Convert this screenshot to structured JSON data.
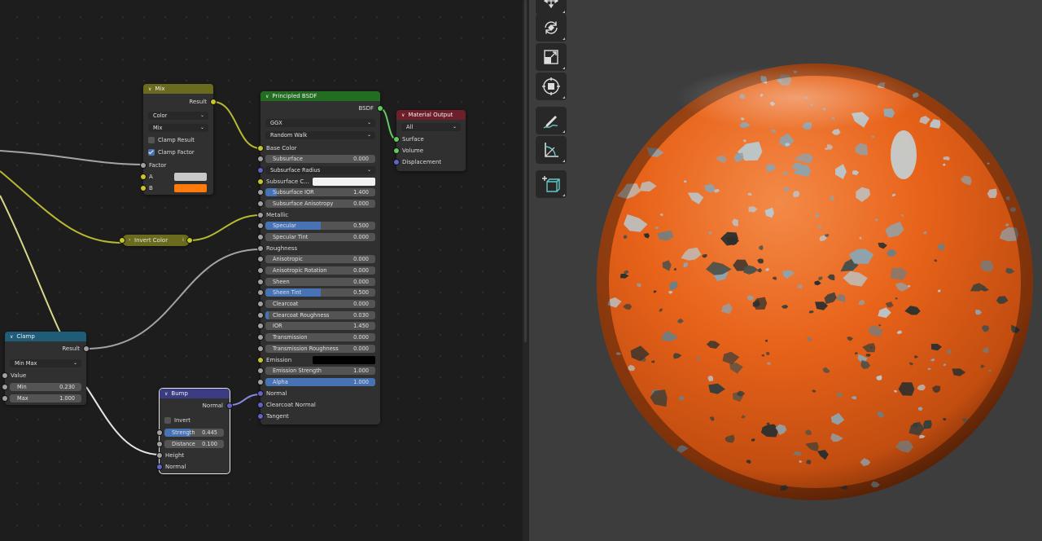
{
  "nodes": {
    "mix": {
      "title": "Mix",
      "output": "Result",
      "type_dropdown": "Color",
      "blend_dropdown": "Mix",
      "clamp_result": {
        "label": "Clamp Result",
        "checked": false
      },
      "clamp_factor": {
        "label": "Clamp Factor",
        "checked": true
      },
      "factor_label": "Factor",
      "a_label": "A",
      "b_label": "B",
      "a_color": "#c8c8c8",
      "b_color": "#ff7a0a",
      "header_color": "#6b6b1f"
    },
    "invert_color": {
      "title": "Invert Color",
      "header_color": "#6b6b1f"
    },
    "clamp": {
      "title": "Clamp",
      "output": "Result",
      "mode_dropdown": "Min Max",
      "value_label": "Value",
      "min": {
        "label": "Min",
        "value": "0.230"
      },
      "max": {
        "label": "Max",
        "value": "1.000"
      },
      "header_color": "#1f5c78"
    },
    "bump": {
      "title": "Bump",
      "output": "Normal",
      "invert": {
        "label": "Invert",
        "checked": false
      },
      "strength": {
        "label": "Strength",
        "value": "0.445",
        "fraction": 0.445
      },
      "distance": {
        "label": "Distance",
        "value": "0.100",
        "fraction": 0.0
      },
      "height_label": "Height",
      "normal_label": "Normal",
      "header_color": "#3c3c83"
    },
    "principled": {
      "title": "Principled BSDF",
      "output": "BSDF",
      "distribution": "GGX",
      "subsurface_method": "Random Walk",
      "base_color_label": "Base Color",
      "subsurface": {
        "label": "Subsurface",
        "value": "0.000",
        "fraction": 0.0
      },
      "subsurface_radius": "Subsurface Radius",
      "subsurface_color": {
        "label": "Subsurface C...",
        "color": "#f2f2f2"
      },
      "subsurface_ior": {
        "label": "Subsurface IOR",
        "value": "1.400",
        "fraction": 0.1
      },
      "subsurface_anisotropy": {
        "label": "Subsurface Anisotropy",
        "value": "0.000",
        "fraction": 0.0
      },
      "metallic_label": "Metallic",
      "specular": {
        "label": "Specular",
        "value": "0.500",
        "fraction": 0.5
      },
      "specular_tint": {
        "label": "Specular Tint",
        "value": "0.000",
        "fraction": 0.0
      },
      "roughness_label": "Roughness",
      "anisotropic": {
        "label": "Anisotropic",
        "value": "0.000",
        "fraction": 0.0
      },
      "anisotropic_rotation": {
        "label": "Anisotropic Rotation",
        "value": "0.000",
        "fraction": 0.0
      },
      "sheen": {
        "label": "Sheen",
        "value": "0.000",
        "fraction": 0.0
      },
      "sheen_tint": {
        "label": "Sheen Tint",
        "value": "0.500",
        "fraction": 0.5
      },
      "clearcoat": {
        "label": "Clearcoat",
        "value": "0.000",
        "fraction": 0.0
      },
      "clearcoat_roughness": {
        "label": "Clearcoat Roughness",
        "value": "0.030",
        "fraction": 0.03
      },
      "ior": {
        "label": "IOR",
        "value": "1.450",
        "fraction": 0.0
      },
      "transmission": {
        "label": "Transmission",
        "value": "0.000",
        "fraction": 0.0
      },
      "transmission_roughness": {
        "label": "Transmission Roughness",
        "value": "0.000",
        "fraction": 0.0
      },
      "emission": {
        "label": "Emission",
        "color": "#000000"
      },
      "emission_strength": {
        "label": "Emission Strength",
        "value": "1.000",
        "fraction": 0.0
      },
      "alpha": {
        "label": "Alpha",
        "value": "1.000",
        "fraction": 1.0
      },
      "normal_label": "Normal",
      "clearcoat_normal_label": "Clearcoat Normal",
      "tangent_label": "Tangent",
      "header_color": "#236d23"
    },
    "material_output": {
      "title": "Material Output",
      "target_dropdown": "All",
      "surface_label": "Surface",
      "volume_label": "Volume",
      "displacement_label": "Displacement",
      "header_color": "#6e1f2a"
    }
  },
  "viewport": {
    "background": "#3d3d3d",
    "tools": [
      "move-tool-icon",
      "rotate-tool-icon",
      "scale-tool-icon",
      "transform-tool-icon",
      "annotate-tool-icon",
      "measure-tool-icon",
      "add-cube-tool-icon"
    ],
    "sphere_color": "#e8631a"
  }
}
